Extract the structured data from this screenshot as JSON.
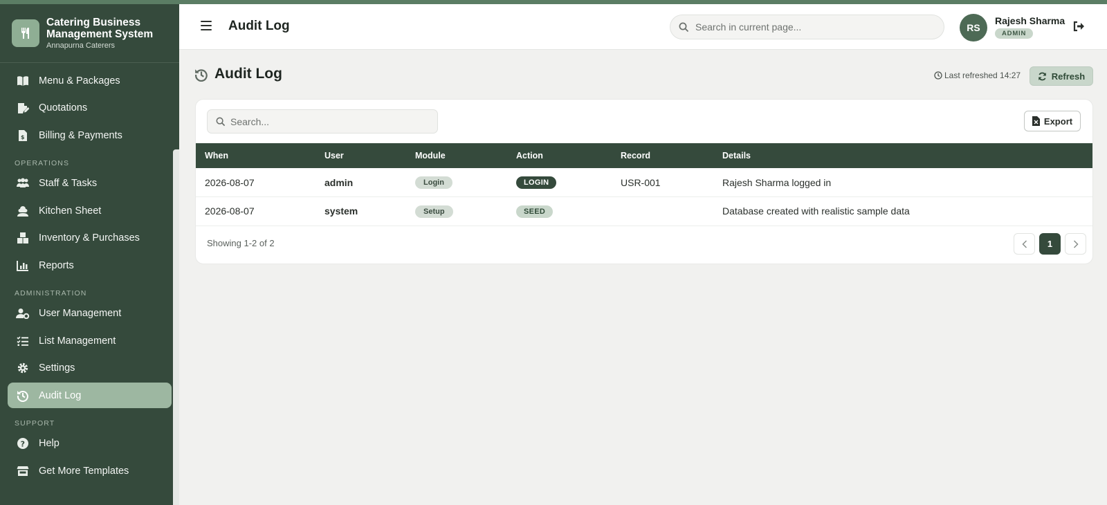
{
  "brand": {
    "title_line1": "Catering Business",
    "title_line2": "Management System",
    "subtitle": "Annapurna Caterers"
  },
  "sidebar": {
    "items_top": [
      {
        "label": "Menu & Packages",
        "icon": "book-icon"
      },
      {
        "label": "Quotations",
        "icon": "edit-document-icon"
      },
      {
        "label": "Billing & Payments",
        "icon": "invoice-icon"
      }
    ],
    "section_operations": "OPERATIONS",
    "items_operations": [
      {
        "label": "Staff & Tasks",
        "icon": "users-icon"
      },
      {
        "label": "Kitchen Sheet",
        "icon": "chef-icon"
      },
      {
        "label": "Inventory & Purchases",
        "icon": "boxes-icon"
      },
      {
        "label": "Reports",
        "icon": "bar-chart-icon"
      }
    ],
    "section_admin": "ADMINISTRATION",
    "items_admin": [
      {
        "label": "User Management",
        "icon": "user-gear-icon"
      },
      {
        "label": "List Management",
        "icon": "list-check-icon"
      },
      {
        "label": "Settings",
        "icon": "gear-icon"
      },
      {
        "label": "Audit Log",
        "icon": "history-icon",
        "active": true
      }
    ],
    "section_support": "SUPPORT",
    "items_support": [
      {
        "label": "Help",
        "icon": "question-circle-icon"
      },
      {
        "label": "Get More Templates",
        "icon": "store-icon"
      }
    ]
  },
  "header": {
    "title": "Audit Log",
    "search_placeholder": "Search in current page...",
    "avatar_initials": "RS",
    "user_name": "Rajesh Sharma",
    "user_role": "ADMIN"
  },
  "main": {
    "page_title": "Audit Log",
    "last_refreshed": "Last refreshed 14:27",
    "refresh_label": "Refresh",
    "search_placeholder": "Search...",
    "export_label": "Export",
    "table": {
      "columns": [
        "When",
        "User",
        "Module",
        "Action",
        "Record",
        "Details"
      ],
      "rows": [
        {
          "when": "2026-08-07",
          "user": "admin",
          "module": "Login",
          "action": "LOGIN",
          "record": "USR-001",
          "details": "Rajesh Sharma logged in"
        },
        {
          "when": "2026-08-07",
          "user": "system",
          "module": "Setup",
          "action": "SEED",
          "record": "",
          "details": "Database created with realistic sample data"
        }
      ]
    },
    "showing": "Showing 1-2 of 2",
    "current_page": "1"
  },
  "colors": {
    "sidebar_bg": "#354a3c",
    "accent": "#5b7d64",
    "active_item": "#9db7a1",
    "badge_light": "#c9d7cb"
  }
}
